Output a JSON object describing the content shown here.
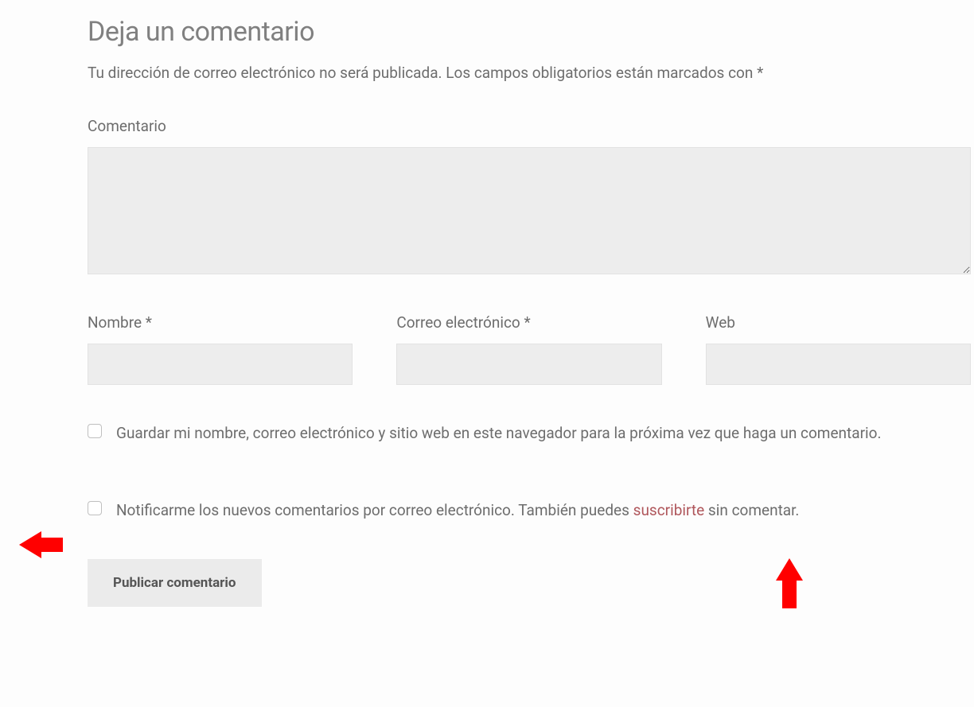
{
  "form": {
    "title": "Deja un comentario",
    "notes": "Tu dirección de correo electrónico no será publicada. Los campos obligatorios están marcados con *",
    "comment_label": "Comentario",
    "name_label": "Nombre *",
    "email_label": "Correo electrónico *",
    "web_label": "Web",
    "save_info_label": "Guardar mi nombre, correo electrónico y sitio web en este navegador para la próxima vez que haga un comentario.",
    "notify_text_before": "Notificarme los nuevos comentarios por correo electrónico. También puedes ",
    "notify_link_text": "suscribirte",
    "notify_text_after": " sin comentar.",
    "submit_label": "Publicar comentario"
  }
}
